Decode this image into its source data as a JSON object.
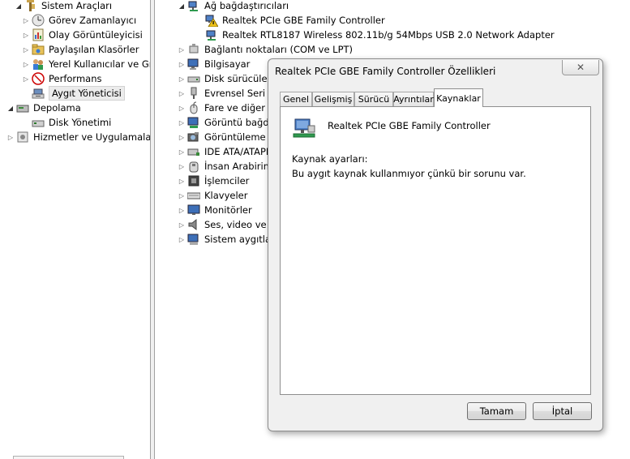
{
  "nav": {
    "items": [
      {
        "label": "Sistem Araçları",
        "icon": "tools-icon",
        "arrow": "open"
      },
      {
        "label": "Görev Zamanlayıcı",
        "icon": "clock-icon",
        "arrow": "closed"
      },
      {
        "label": "Olay Görüntüleyicisi",
        "icon": "event-viewer-icon",
        "arrow": "closed"
      },
      {
        "label": "Paylaşılan Klasörler",
        "icon": "shared-folder-icon",
        "arrow": "closed"
      },
      {
        "label": "Yerel Kullanıcılar ve Gru",
        "icon": "users-icon",
        "arrow": "closed"
      },
      {
        "label": "Performans",
        "icon": "performance-icon",
        "arrow": "closed"
      },
      {
        "label": "Aygıt Yöneticisi",
        "icon": "device-manager-icon",
        "arrow": "none"
      },
      {
        "label": "Depolama",
        "icon": "storage-icon",
        "arrow": "open"
      },
      {
        "label": "Disk Yönetimi",
        "icon": "disk-icon",
        "arrow": "none"
      },
      {
        "label": "Hizmetler ve Uygulamalar",
        "icon": "services-icon",
        "arrow": "closed"
      }
    ]
  },
  "tree": {
    "items": [
      {
        "label": "Ağ bağdaştırıcıları",
        "icon": "network-adapter-icon",
        "arrow": "open"
      },
      {
        "label": "Realtek PCIe GBE Family Controller",
        "icon": "network-warning-icon",
        "arrow": "none"
      },
      {
        "label": "Realtek RTL8187 Wireless 802.11b/g 54Mbps USB 2.0 Network Adapter",
        "icon": "network-card-icon",
        "arrow": "none"
      },
      {
        "label": "Bağlantı noktaları (COM ve LPT)",
        "icon": "port-icon",
        "arrow": "closed"
      },
      {
        "label": "Bilgisayar",
        "icon": "computer-icon",
        "arrow": "closed"
      },
      {
        "label": "Disk sürücüleri",
        "icon": "disk-drive-icon",
        "arrow": "closed"
      },
      {
        "label": "Evrensel Seri Veri Yolu denetleyicileri",
        "icon": "usb-icon",
        "arrow": "closed"
      },
      {
        "label": "Fare ve diğer işaret aygıtları",
        "icon": "mouse-icon",
        "arrow": "closed"
      },
      {
        "label": "Görüntü bağdaştırıcıları",
        "icon": "display-adapter-icon",
        "arrow": "closed"
      },
      {
        "label": "Görüntüleme aygıtları",
        "icon": "camera-icon",
        "arrow": "closed"
      },
      {
        "label": "IDE ATA/ATAPI denetleyicileri",
        "icon": "ide-icon",
        "arrow": "closed"
      },
      {
        "label": "İnsan Arabirim Aygıtları",
        "icon": "hid-icon",
        "arrow": "closed"
      },
      {
        "label": "İşlemciler",
        "icon": "processor-icon",
        "arrow": "closed"
      },
      {
        "label": "Klavyeler",
        "icon": "keyboard-icon",
        "arrow": "closed"
      },
      {
        "label": "Monitörler",
        "icon": "monitor-icon",
        "arrow": "closed"
      },
      {
        "label": "Ses, video ve oyun denetleyicileri",
        "icon": "speaker-icon",
        "arrow": "closed"
      },
      {
        "label": "Sistem aygıtları",
        "icon": "system-device-icon",
        "arrow": "closed"
      }
    ]
  },
  "dialog": {
    "title": "Realtek PCIe GBE Family Controller Özellikleri",
    "close_glyph": "✕",
    "tabs": [
      {
        "label": "Genel"
      },
      {
        "label": "Gelişmiş"
      },
      {
        "label": "Sürücü"
      },
      {
        "label": "Ayrıntılar"
      },
      {
        "label": "Kaynaklar"
      }
    ],
    "active_tab": "Kaynaklar",
    "device_name": "Realtek PCIe GBE Family Controller",
    "resource_label": "Kaynak ayarları:",
    "resource_message": "Bu aygıt kaynak kullanmıyor çünkü bir sorunu var.",
    "ok_label": "Tamam",
    "cancel_label": "İptal"
  },
  "colors": {
    "window_bg": "#ffffff",
    "dialog_bg": "#f0f0f0",
    "selection_bg": "#ececec"
  }
}
